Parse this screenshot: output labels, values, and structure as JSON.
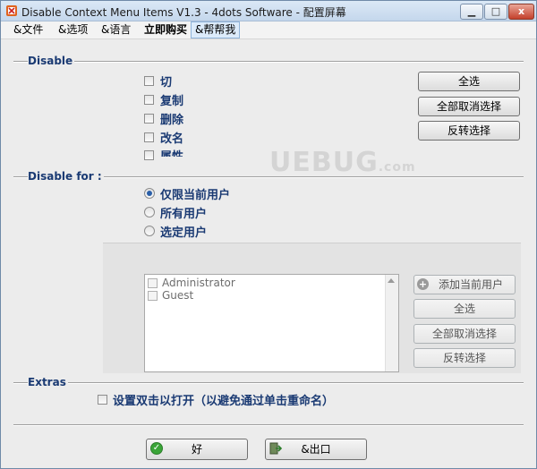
{
  "window": {
    "title": "Disable Context Menu Items V1.3 - 4dots Software - 配置屏幕",
    "min_label": "▭",
    "max_label": "□",
    "close_label": "x"
  },
  "menu": {
    "file": "&文件",
    "options": "&选项",
    "language": "&语言",
    "buy": "立即购买",
    "help": "&帮帮我"
  },
  "disable": {
    "section_label": "Disable",
    "items": [
      "切",
      "复制",
      "删除",
      "改名",
      "属性"
    ],
    "select_all": "全选",
    "unselect_all": "全部取消选择",
    "invert": "反转选择"
  },
  "disable_for": {
    "section_label": "Disable for :",
    "options": [
      "仅限当前用户",
      "所有用户",
      "选定用户"
    ],
    "selected_index": 0
  },
  "users": {
    "list": [
      "Administrator",
      "Guest"
    ],
    "add_current": "添加当前用户",
    "select_all": "全选",
    "unselect_all": "全部取消选择",
    "invert": "反转选择"
  },
  "extras": {
    "section_label": "Extras",
    "double_click": "设置双击以打开（以避免通过单击重命名）"
  },
  "footer": {
    "ok": "好",
    "exit": "&出口"
  },
  "watermark": {
    "main": "UEBUG",
    "sub": ".com"
  }
}
